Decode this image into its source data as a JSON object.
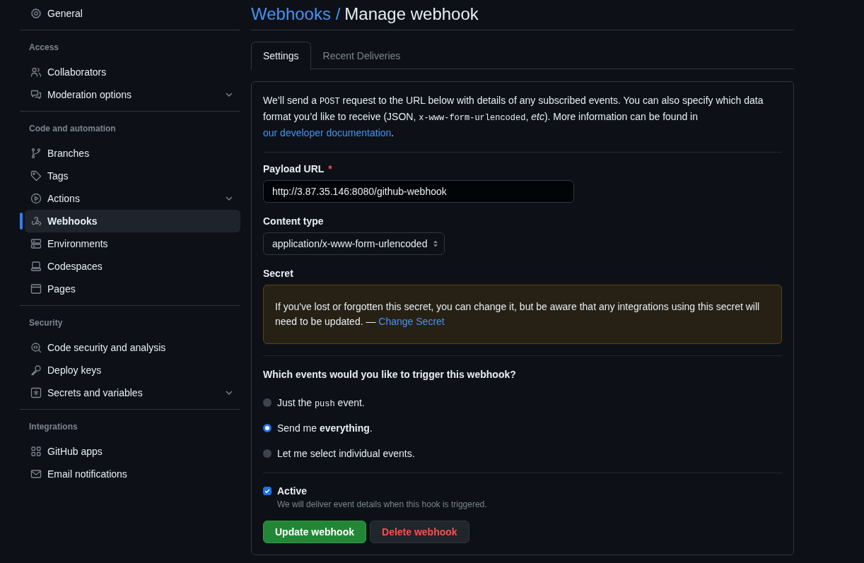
{
  "sidebar": {
    "groups": [
      {
        "items": [
          {
            "label": "General",
            "selected": false,
            "expandable": false
          }
        ]
      },
      {
        "heading": "Access",
        "items": [
          {
            "label": "Collaborators",
            "selected": false,
            "expandable": false
          },
          {
            "label": "Moderation options",
            "selected": false,
            "expandable": true
          }
        ]
      },
      {
        "heading": "Code and automation",
        "items": [
          {
            "label": "Branches",
            "selected": false,
            "expandable": false
          },
          {
            "label": "Tags",
            "selected": false,
            "expandable": false
          },
          {
            "label": "Actions",
            "selected": false,
            "expandable": true
          },
          {
            "label": "Webhooks",
            "selected": true,
            "expandable": false
          },
          {
            "label": "Environments",
            "selected": false,
            "expandable": false
          },
          {
            "label": "Codespaces",
            "selected": false,
            "expandable": false
          },
          {
            "label": "Pages",
            "selected": false,
            "expandable": false
          }
        ]
      },
      {
        "heading": "Security",
        "items": [
          {
            "label": "Code security and analysis",
            "selected": false,
            "expandable": false
          },
          {
            "label": "Deploy keys",
            "selected": false,
            "expandable": false
          },
          {
            "label": "Secrets and variables",
            "selected": false,
            "expandable": true
          }
        ]
      },
      {
        "heading": "Integrations",
        "items": [
          {
            "label": "GitHub apps",
            "selected": false,
            "expandable": false
          },
          {
            "label": "Email notifications",
            "selected": false,
            "expandable": false
          }
        ]
      }
    ]
  },
  "header": {
    "breadcrumb": "Webhooks /",
    "title": "Manage webhook"
  },
  "tabs": [
    {
      "label": "Settings",
      "selected": true
    },
    {
      "label": "Recent Deliveries",
      "selected": false
    }
  ],
  "form": {
    "intro": [
      {
        "kind": "text",
        "text": "We’ll send a "
      },
      {
        "kind": "code",
        "text": "POST"
      },
      {
        "kind": "text",
        "text": " request to the URL below with details of any subscribed events. You can also specify which data format you’d like to receive (JSON, "
      },
      {
        "kind": "code",
        "text": "x-www-form-urlencoded"
      },
      {
        "kind": "text",
        "text": ", "
      },
      {
        "kind": "italic",
        "text": "etc"
      },
      {
        "kind": "text",
        "text": "). More information can be found in "
      },
      {
        "kind": "link",
        "text": "our developer documentation"
      },
      {
        "kind": "text",
        "text": "."
      }
    ],
    "payload_url": {
      "label": "Payload URL",
      "required_mark": "*",
      "value": "http://3.87.35.146:8080/github-webhook"
    },
    "content_type": {
      "label": "Content type",
      "value": "application/x-www-form-urlencoded"
    },
    "secret": {
      "label": "Secret",
      "notice": "If you've lost or forgotten this secret, you can change it, but be aware that any integrations using this secret will need to be updated. — ",
      "link": "Change Secret"
    },
    "events": {
      "question": "Which events would you like to trigger this webhook?",
      "options": [
        {
          "selected": false,
          "parts": [
            {
              "kind": "text",
              "text": "Just the "
            },
            {
              "kind": "code",
              "text": "push"
            },
            {
              "kind": "text",
              "text": " event."
            }
          ]
        },
        {
          "selected": true,
          "parts": [
            {
              "kind": "text",
              "text": "Send me "
            },
            {
              "kind": "bold",
              "text": "everything"
            },
            {
              "kind": "text",
              "text": "."
            }
          ]
        },
        {
          "selected": false,
          "parts": [
            {
              "kind": "text",
              "text": "Let me select individual events."
            }
          ]
        }
      ]
    },
    "active": {
      "label": "Active",
      "checked": true,
      "hint": "We will deliver event details when this hook is triggered."
    },
    "buttons": [
      {
        "kind": "primary",
        "label": "Update webhook"
      },
      {
        "kind": "danger",
        "label": "Delete webhook"
      }
    ]
  }
}
